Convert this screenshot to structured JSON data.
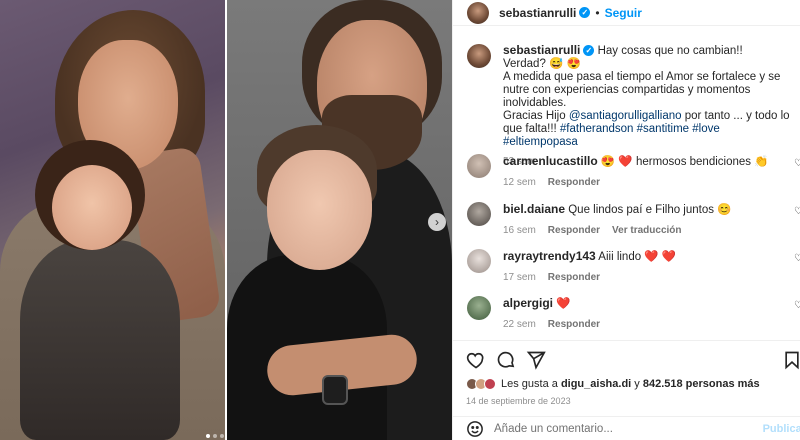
{
  "post": {
    "username": "sebastianrulli",
    "follow_label": "Seguir",
    "separator": "•",
    "caption_lines": "Hay cosas que no cambian!!\nVerdad? 😅 😍\nA medida que pasa el tiempo el Amor se fortalece y se nutre con experiencias compartidas y momentos inolvidables.\nGracias Hijo ",
    "mention": "@santiagorulligalliano",
    "caption_after_mention": " por tanto ... y todo lo que falta!!! ",
    "hashtags": "#fatherandson #santitime #love #eltiempopasa",
    "time_ago": "53 sem"
  },
  "comments": [
    {
      "user": "carmenlucastillo",
      "text": "😍 ❤️ hermosos bendiciones 👏",
      "time": "12 sem",
      "reply": "Responder",
      "extra": ""
    },
    {
      "user": "biel.daiane",
      "text": "Que lindos paí e Filho juntos 😊",
      "time": "16 sem",
      "reply": "Responder",
      "extra": "Ver traducción"
    },
    {
      "user": "rayraytrendy143",
      "text": "Aiii lindo ❤️ ❤️",
      "time": "17 sem",
      "reply": "Responder",
      "extra": ""
    },
    {
      "user": "alpergigi",
      "text": "❤️",
      "time": "22 sem",
      "reply": "Responder",
      "extra": ""
    }
  ],
  "icons": {
    "like": "heart-outline-icon",
    "comment": "comment-bubble-icon",
    "share": "paper-plane-icon",
    "save": "bookmark-icon",
    "next": "chevron-right-icon",
    "comment_like": "small-heart-icon"
  },
  "likes": {
    "prefix": "Les gusta a",
    "user": "digu_aisha.di",
    "middle": "y",
    "count": "842.518 personas más"
  },
  "date": "14 de septiembre de 2023",
  "add_comment": {
    "placeholder": "Añade un comentario...",
    "publish": "Publicar"
  },
  "colors": {
    "accent": "#0095f6",
    "heart": "#ed1c24",
    "muted": "#8e8e8e"
  }
}
